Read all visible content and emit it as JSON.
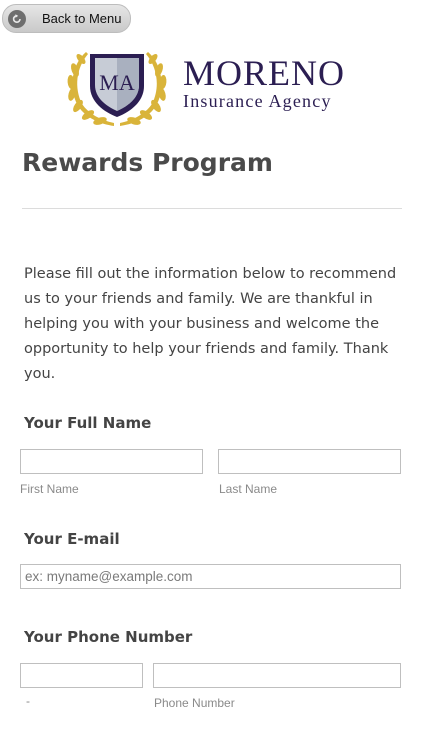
{
  "back_button": {
    "label": "Back to Menu",
    "icon": "back-arrow-icon"
  },
  "logo": {
    "monogram": "MA",
    "name": "MORENO",
    "subtitle": "Insurance Agency",
    "colors": {
      "navy": "#2b1e52",
      "gold": "#d9b43a",
      "silver": "#c7ccd6"
    }
  },
  "page": {
    "title": "Rewards Program"
  },
  "intro": {
    "text": "Please fill out the information below to recommend us to your friends and family. We are thankful in helping you with your business and welcome the opportunity to help your friends and family. Thank you."
  },
  "form": {
    "full_name": {
      "label": "Your Full Name",
      "first_name": {
        "value": "",
        "sublabel": "First Name"
      },
      "last_name": {
        "value": "",
        "sublabel": "Last Name"
      }
    },
    "email": {
      "label": "Your E-mail",
      "value": "",
      "placeholder": "ex: myname@example.com"
    },
    "phone": {
      "label": "Your Phone Number",
      "area_code": {
        "value": "",
        "sublabel": "-"
      },
      "number": {
        "value": "",
        "sublabel": "Phone Number"
      }
    }
  }
}
